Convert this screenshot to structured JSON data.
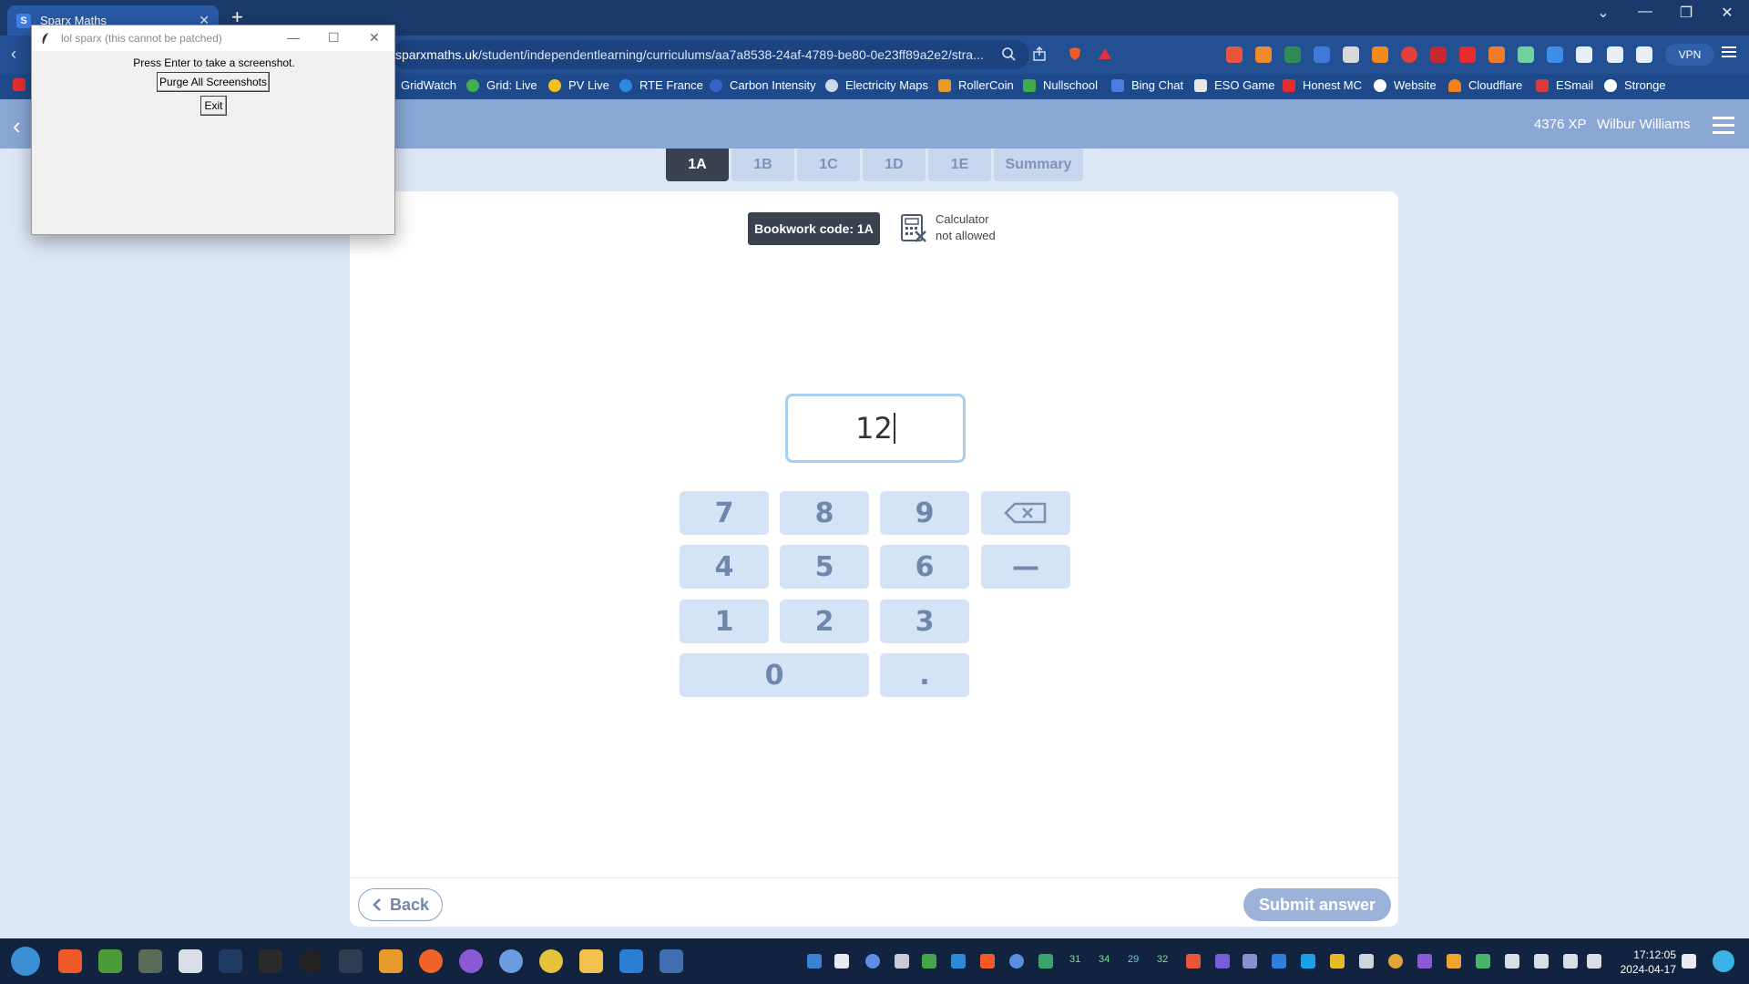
{
  "browser": {
    "tab_title": "Sparx Maths",
    "tab_favicon": "S",
    "new_tab": "+",
    "url_host": "sparxmaths.uk",
    "url_path": "/student/independentlearning/curriculums/aa7a8538-24af-4789-be80-0e23ff89a2e2/stra...",
    "vpn_label": "VPN",
    "window_controls": [
      "⌄",
      "—",
      "❐",
      "✕"
    ]
  },
  "bookmarks": [
    {
      "label": "GridWatch",
      "color": "#1e4a8c"
    },
    {
      "label": "Grid: Live",
      "color": "#41b04a"
    },
    {
      "label": "PV Live",
      "color": "#f4c21a"
    },
    {
      "label": "RTE France",
      "color": "#2a8ae0"
    },
    {
      "label": "Carbon Intensity",
      "color": "#3565c9"
    },
    {
      "label": "Electricity Maps",
      "color": "#cfd8e6"
    },
    {
      "label": "RollerCoin",
      "color": "#e79b2a"
    },
    {
      "label": "Nullschool",
      "color": "#3fae49"
    },
    {
      "label": "Bing Chat",
      "color": "#4a7ce4"
    },
    {
      "label": "ESO Game",
      "color": "#e8e8e8"
    },
    {
      "label": "Honest MC",
      "color": "#e62d2d"
    },
    {
      "label": "Website",
      "color": "#ffffff"
    },
    {
      "label": "Cloudflare",
      "color": "#f48120"
    },
    {
      "label": "ESmail",
      "color": "#d93b3b"
    },
    {
      "label": "Stronge",
      "color": "#ffffff"
    }
  ],
  "sparx": {
    "back_arrow": "‹",
    "xp": "4376 XP",
    "user_name": "Wilbur Williams",
    "tabs": [
      "1A",
      "1B",
      "1C",
      "1D",
      "1E",
      "Summary"
    ],
    "active_tab": "1A",
    "bookwork_code": "Bookwork code: 1A",
    "calculator_line1": "Calculator",
    "calculator_line2": "not allowed",
    "answer_value": "12",
    "keypad": [
      "7",
      "8",
      "9",
      "⌫",
      "4",
      "5",
      "6",
      "—",
      "1",
      "2",
      "3",
      "0",
      "."
    ],
    "back_label": "Back",
    "submit_label": "Submit answer"
  },
  "overlay_window": {
    "title": "lol sparx (this cannot be patched)",
    "message": "Press Enter to take a screenshot.",
    "purge_button": "Purge All Screenshots",
    "exit_button": "Exit"
  },
  "taskbar": {
    "clock_time": "17:12:05",
    "clock_date": "2024-04-17",
    "tray_numbers": [
      "31",
      "34",
      "29",
      "32"
    ]
  },
  "colors": {
    "header": "#8aa7d6",
    "active_tab": "#3a4250",
    "keypad_key": "#d5e3f7",
    "submit_button": "#9db2d8"
  }
}
